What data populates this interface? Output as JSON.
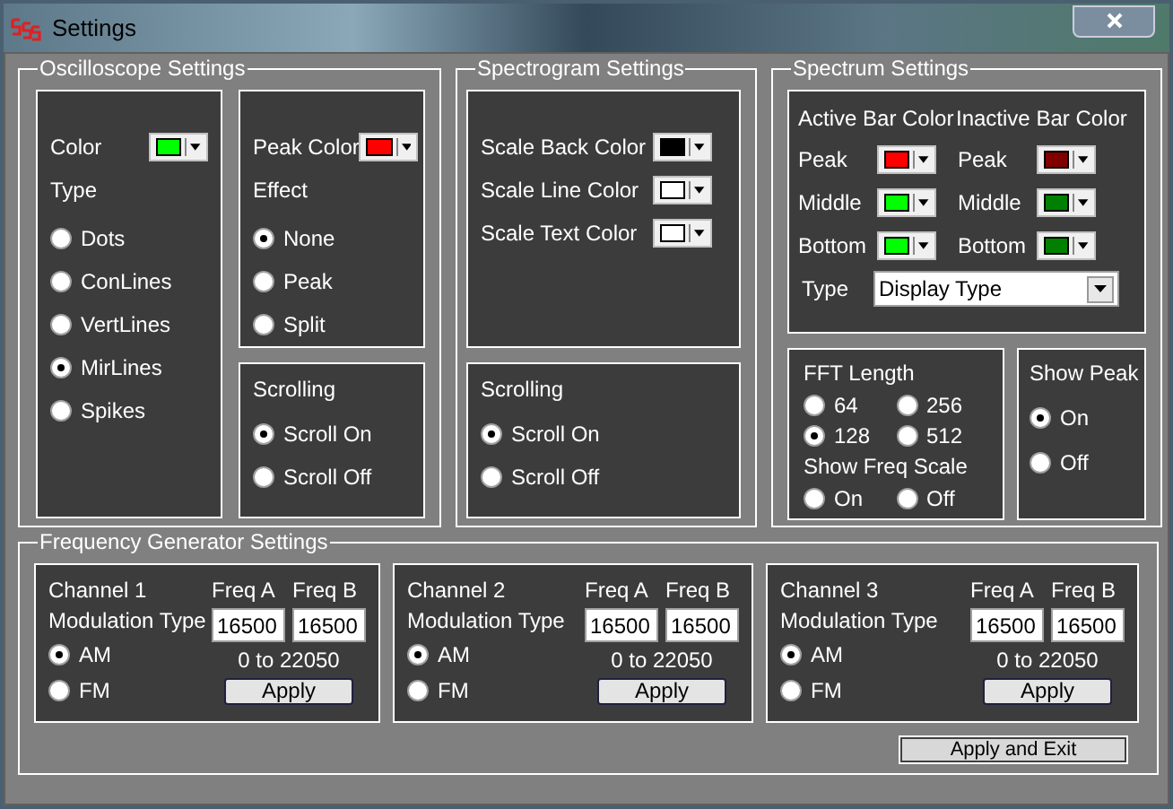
{
  "window": {
    "title": "Settings"
  },
  "oscilloscope": {
    "title": "Oscilloscope Settings",
    "color": {
      "label": "Color",
      "color": "#00ff00"
    },
    "type": {
      "label": "Type",
      "options": [
        {
          "label": "Dots",
          "selected": false
        },
        {
          "label": "ConLines",
          "selected": false
        },
        {
          "label": "VertLines",
          "selected": false
        },
        {
          "label": "MirLines",
          "selected": true
        },
        {
          "label": "Spikes",
          "selected": false
        }
      ]
    },
    "peak_color": {
      "label": "Peak Color",
      "color": "#ff0000"
    },
    "effect": {
      "label": "Effect",
      "options": [
        {
          "label": "None",
          "selected": true
        },
        {
          "label": "Peak",
          "selected": false
        },
        {
          "label": "Split",
          "selected": false
        }
      ]
    },
    "scrolling": {
      "label": "Scrolling",
      "options": [
        {
          "label": "Scroll On",
          "selected": true
        },
        {
          "label": "Scroll Off",
          "selected": false
        }
      ]
    }
  },
  "spectrogram": {
    "title": "Spectrogram Settings",
    "colors": [
      {
        "label": "Scale Back Color",
        "color": "#000000"
      },
      {
        "label": "Scale Line Color",
        "color": "#ffffff"
      },
      {
        "label": "Scale Text Color",
        "color": "#ffffff"
      }
    ],
    "scrolling": {
      "label": "Scrolling",
      "options": [
        {
          "label": "Scroll On",
          "selected": true
        },
        {
          "label": "Scroll Off",
          "selected": false
        }
      ]
    }
  },
  "spectrum": {
    "title": "Spectrum Settings",
    "active": {
      "label": "Active Bar Color",
      "rows": [
        {
          "label": "Peak",
          "color": "#ff0000"
        },
        {
          "label": "Middle",
          "color": "#00ff00"
        },
        {
          "label": "Bottom",
          "color": "#00ff00"
        }
      ]
    },
    "inactive": {
      "label": "Inactive Bar Color",
      "rows": [
        {
          "label": "Peak",
          "color": "#800000"
        },
        {
          "label": "Middle",
          "color": "#008000"
        },
        {
          "label": "Bottom",
          "color": "#008000"
        }
      ]
    },
    "type": {
      "label": "Type",
      "value": "Display Type"
    },
    "fft": {
      "label": "FFT Length",
      "options": [
        {
          "label": "64",
          "selected": false
        },
        {
          "label": "256",
          "selected": false
        },
        {
          "label": "128",
          "selected": true
        },
        {
          "label": "512",
          "selected": false
        }
      ]
    },
    "show_freq_scale": {
      "label": "Show Freq Scale",
      "options": [
        {
          "label": "On",
          "selected": false
        },
        {
          "label": "Off",
          "selected": false
        }
      ]
    },
    "show_peak": {
      "label": "Show Peak",
      "options": [
        {
          "label": "On",
          "selected": true
        },
        {
          "label": "Off",
          "selected": false
        }
      ]
    }
  },
  "frequency_generator": {
    "title": "Frequency Generator Settings",
    "channels": [
      {
        "label": "Channel 1",
        "modulation_label": "Modulation Type",
        "options": [
          {
            "label": "AM",
            "selected": true
          },
          {
            "label": "FM",
            "selected": false
          }
        ],
        "freq_a_label": "Freq A",
        "freq_b_label": "Freq B",
        "freq_a": "16500",
        "freq_b": "16500",
        "range": "0 to 22050",
        "apply": "Apply"
      },
      {
        "label": "Channel 2",
        "modulation_label": "Modulation Type",
        "options": [
          {
            "label": "AM",
            "selected": true
          },
          {
            "label": "FM",
            "selected": false
          }
        ],
        "freq_a_label": "Freq A",
        "freq_b_label": "Freq B",
        "freq_a": "16500",
        "freq_b": "16500",
        "range": "0 to 22050",
        "apply": "Apply"
      },
      {
        "label": "Channel 3",
        "modulation_label": "Modulation Type",
        "options": [
          {
            "label": "AM",
            "selected": true
          },
          {
            "label": "FM",
            "selected": false
          }
        ],
        "freq_a_label": "Freq A",
        "freq_b_label": "Freq B",
        "freq_a": "16500",
        "freq_b": "16500",
        "range": "0 to 22050",
        "apply": "Apply"
      }
    ]
  },
  "apply_exit": "Apply and Exit"
}
